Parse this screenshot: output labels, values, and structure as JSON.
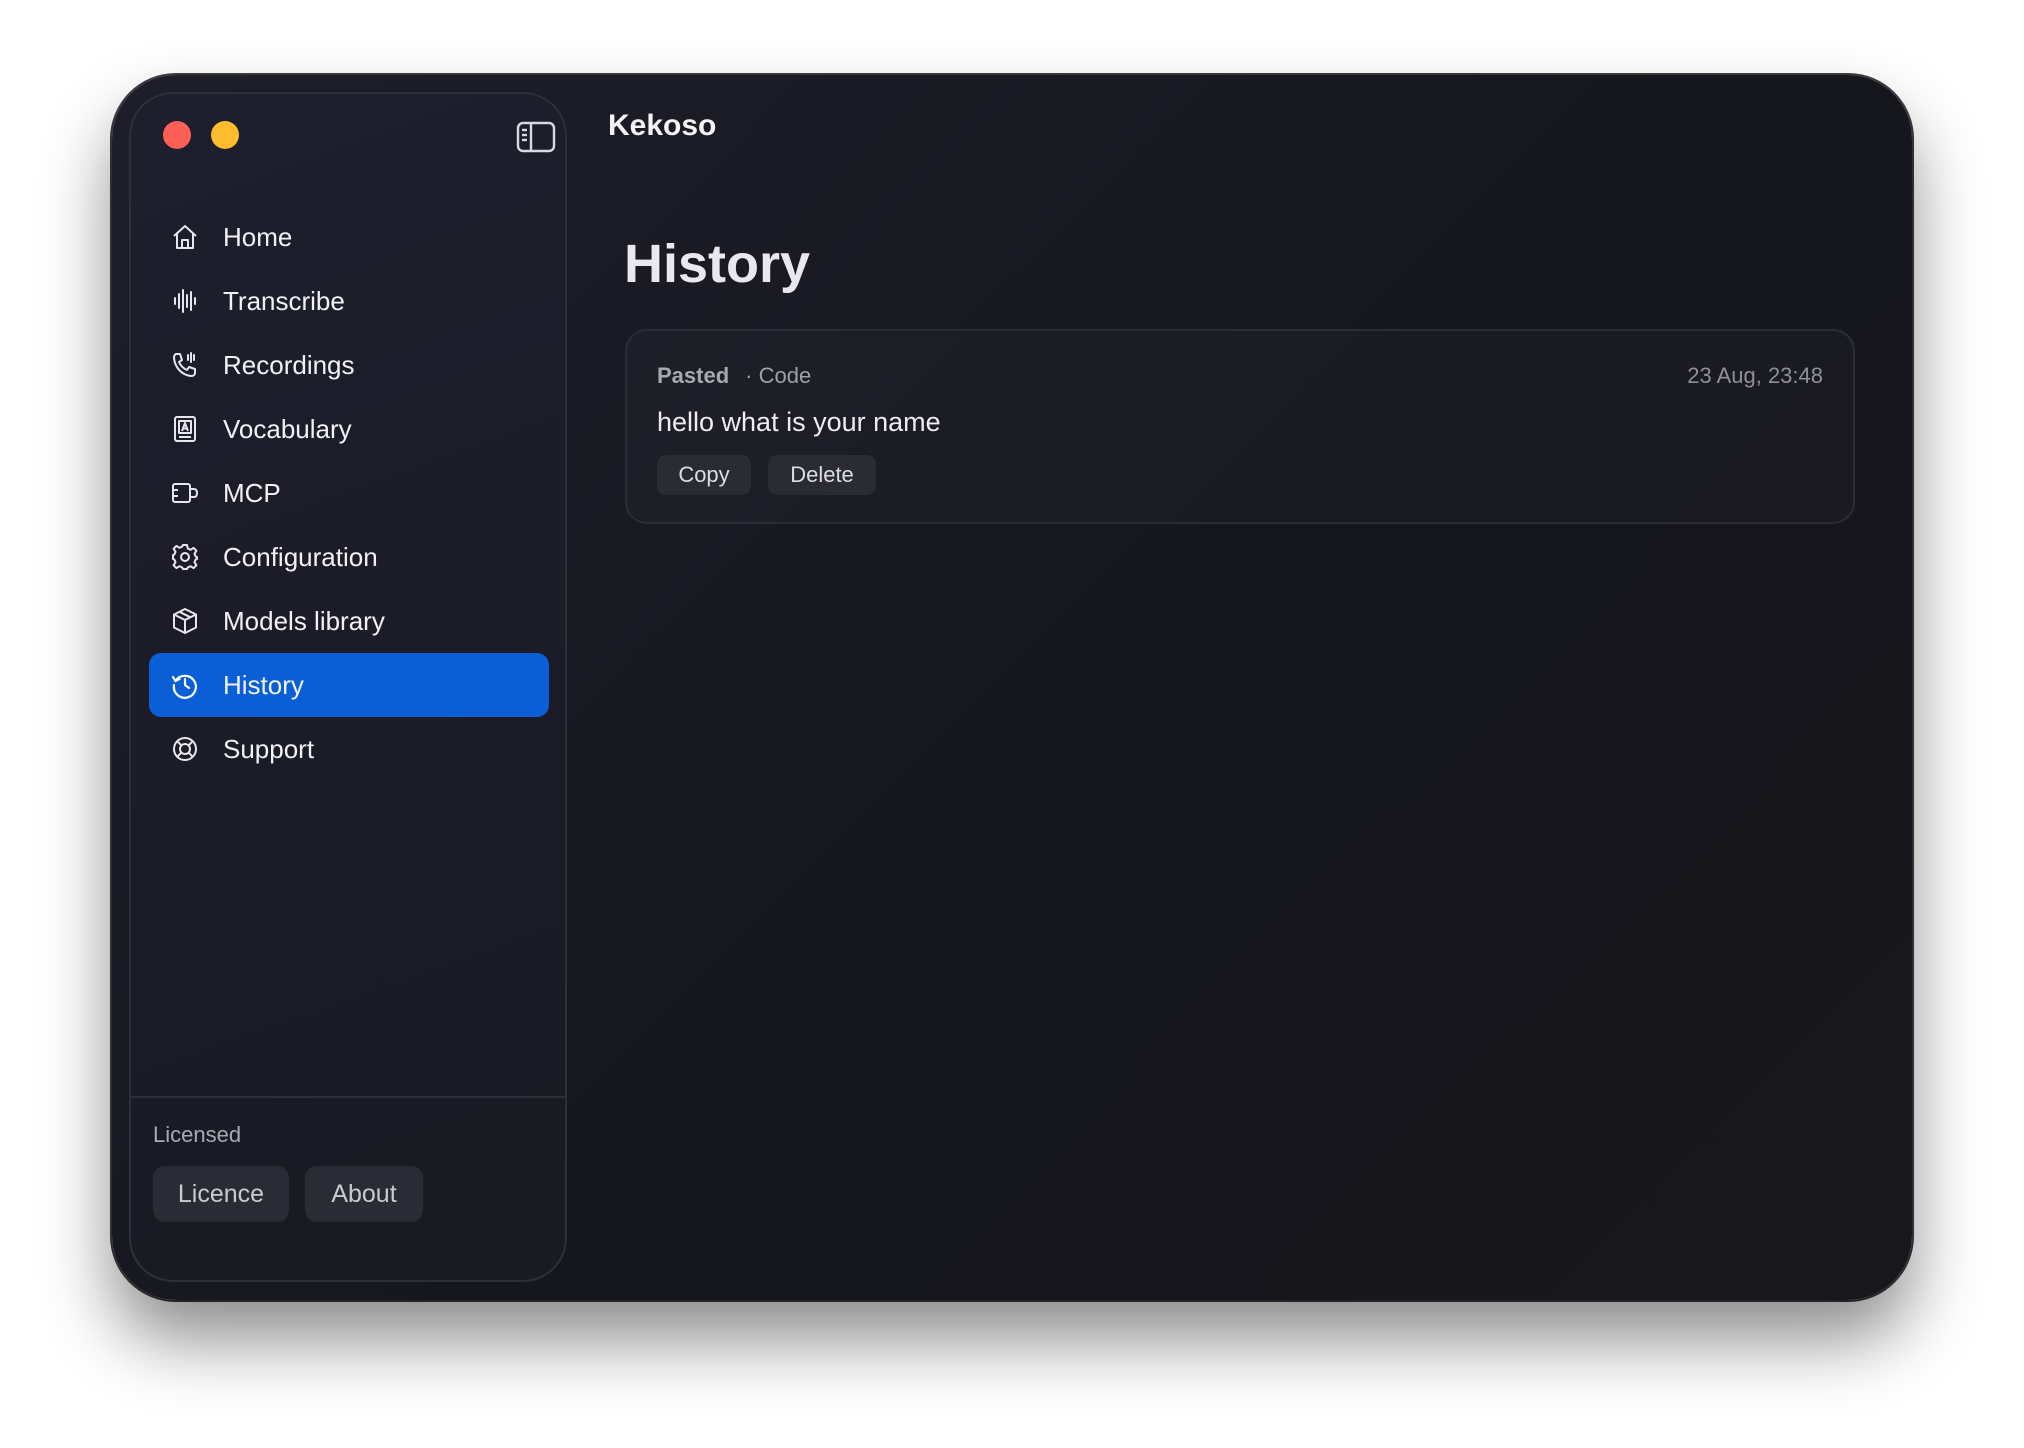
{
  "app": {
    "title": "Kekoso"
  },
  "sidebar": {
    "items": [
      {
        "label": "Home",
        "icon": "home-icon",
        "active": false
      },
      {
        "label": "Transcribe",
        "icon": "waveform-icon",
        "active": false
      },
      {
        "label": "Recordings",
        "icon": "phone-wave-icon",
        "active": false
      },
      {
        "label": "Vocabulary",
        "icon": "dictionary-icon",
        "active": false
      },
      {
        "label": "MCP",
        "icon": "plug-icon",
        "active": false
      },
      {
        "label": "Configuration",
        "icon": "gear-icon",
        "active": false
      },
      {
        "label": "Models library",
        "icon": "cube-icon",
        "active": false
      },
      {
        "label": "History",
        "icon": "history-icon",
        "active": true
      },
      {
        "label": "Support",
        "icon": "lifebuoy-icon",
        "active": false
      }
    ],
    "footer": {
      "status": "Licensed",
      "licence_label": "Licence",
      "about_label": "About"
    }
  },
  "main": {
    "page_title": "History",
    "entries": [
      {
        "source": "Pasted",
        "mode": "· Code",
        "timestamp": "23 Aug, 23:48",
        "text": "hello what is your name",
        "copy_label": "Copy",
        "delete_label": "Delete"
      }
    ]
  },
  "colors": {
    "accent": "#0a5fd7",
    "close": "#fe5f57",
    "minimize": "#febc2e"
  }
}
